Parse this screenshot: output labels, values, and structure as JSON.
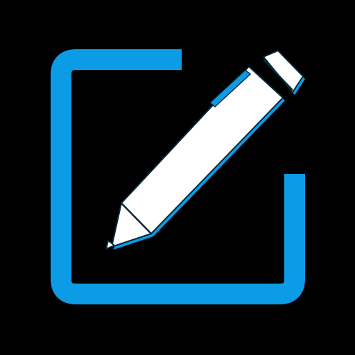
{
  "icon": {
    "name": "edit-icon",
    "background": "#000000",
    "frame_color": "#0B9CE5",
    "pen_color": "#FFFFFF",
    "pen_shadow_color": "#0B9CE5",
    "outline_color": "#062A3A"
  }
}
